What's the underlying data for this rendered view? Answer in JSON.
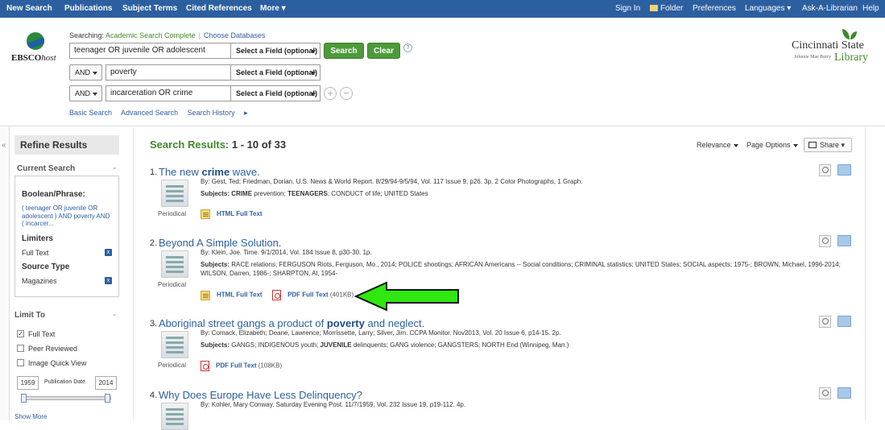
{
  "topnav": {
    "left": [
      "New Search",
      "Publications",
      "Subject Terms",
      "Cited References",
      "More"
    ],
    "right": [
      "Sign In",
      "Folder",
      "Preferences",
      "Languages",
      "Ask-A-Librarian",
      "Help"
    ]
  },
  "brand": {
    "logo": "EBSCOhost",
    "library_logo": {
      "line1": "Cincinnati State",
      "line2": "Johnnie Mae Berry",
      "line3": "Library"
    }
  },
  "search": {
    "searching_label": "Searching:",
    "database": "Academic Search Complete",
    "choose_db": "Choose Databases",
    "rows": [
      {
        "bool": "",
        "query": "teenager OR juvenile OR adolescent",
        "field": "Select a Field (optional)"
      },
      {
        "bool": "AND",
        "query": "poverty",
        "field": "Select a Field (optional)"
      },
      {
        "bool": "AND",
        "query": "incarceration OR crime",
        "field": "Select a Field (optional)"
      }
    ],
    "search_btn": "Search",
    "clear_btn": "Clear",
    "help": "?",
    "links": [
      "Basic Search",
      "Advanced Search",
      "Search History"
    ]
  },
  "sidebar": {
    "refine": "Refine Results",
    "current_search": "Current Search",
    "boolean_label": "Boolean/Phrase:",
    "boolean_query": "( teenager OR juvenile OR adolescent ) AND poverty AND ( incarcer...",
    "limiters_label": "Limiters",
    "limiter_value": "Full Text",
    "source_type_label": "Source Type",
    "source_type_value": "Magazines",
    "limit_to": "Limit To",
    "checkboxes": [
      {
        "label": "Full Text",
        "checked": true
      },
      {
        "label": "Peer Reviewed",
        "checked": false
      },
      {
        "label": "Image Quick View",
        "checked": false
      }
    ],
    "year_from": "1959",
    "year_to": "2014",
    "pub_date_label": "Publication Date",
    "show_more": "Show More"
  },
  "results": {
    "title_label": "Search Results:",
    "count": "1 - 10 of 33",
    "relevance": "Relevance",
    "page_options": "Page Options",
    "share": "Share",
    "items": [
      {
        "num": "1.",
        "title_parts": [
          "The new ",
          "crime",
          " wave."
        ],
        "type": "Periodical",
        "meta": "By: Gest, Ted; Friedman, Dorian. U.S. News & World Report. 8/29/94-9/5/94, Vol. 117 Issue 9, p26. 3p. 2 Color Photographs, 1 Graph.",
        "subjects_label": "Subjects:",
        "subjects_html": "<b>CRIME</b> prevention; <b>TEENAGERS</b>; CONDUCT of life; UNITED States",
        "links": [
          {
            "kind": "html",
            "label": "HTML Full Text",
            "size": ""
          }
        ]
      },
      {
        "num": "2.",
        "title_parts": [
          "Beyond A Simple Solution.",
          "",
          ""
        ],
        "type": "Periodical",
        "meta": "By: Klein, Joe. Time. 9/1/2014, Vol. 184 Issue 8, p30-30. 1p.",
        "subjects_label": "Subjects:",
        "subjects_html": "RACE relations; FERGUSON Riots, Ferguson, Mo., 2014; POLICE shootings; AFRICAN Americans -- Social conditions; CRIMINAL statistics; UNITED States; SOCIAL aspects; 1975-; BROWN, Michael, 1996-2014; WILSON, Darren, 1986-; SHARPTON, Al, 1954-",
        "links": [
          {
            "kind": "html",
            "label": "HTML Full Text",
            "size": ""
          },
          {
            "kind": "pdf",
            "label": "PDF Full Text",
            "size": "(401KB)"
          }
        ]
      },
      {
        "num": "3.",
        "title_parts": [
          "Aboriginal street gangs a product of ",
          "poverty",
          " and neglect."
        ],
        "type": "Periodical",
        "meta": "By: Comack, Elizabeth; Deane, Lawrence; Morrissette, Larry; Silver, Jim. CCPA Monitor. Nov2013, Vol. 20 Issue 6, p14-15. 2p.",
        "subjects_label": "Subjects:",
        "subjects_html": "GANGS; INDIGENOUS youth; <b>JUVENILE</b> delinquents; GANG violence; GANGSTERS; NORTH End (Winnipeg, Man.)",
        "links": [
          {
            "kind": "pdf",
            "label": "PDF Full Text",
            "size": "(108KB)"
          }
        ]
      },
      {
        "num": "4.",
        "title_parts": [
          "Why Does Europe Have Less Delinquency?",
          "",
          ""
        ],
        "type": "Periodical",
        "meta": "By: Kohler, Mary Conway. Saturday Evening Post. 11/7/1959, Vol. 232 Issue 19, p19-112. 4p.",
        "subjects_label": "",
        "subjects_html": "",
        "links": []
      }
    ]
  },
  "colors": {
    "nav": "#2c5fa0",
    "accent_green": "#3f8a2b",
    "arrow": "#2ee80f"
  },
  "icons": [
    "folder-icon",
    "magnify-icon",
    "add-to-folder-icon",
    "html-fulltext-icon",
    "pdf-icon",
    "periodical-icon",
    "green-arrow-icon"
  ]
}
